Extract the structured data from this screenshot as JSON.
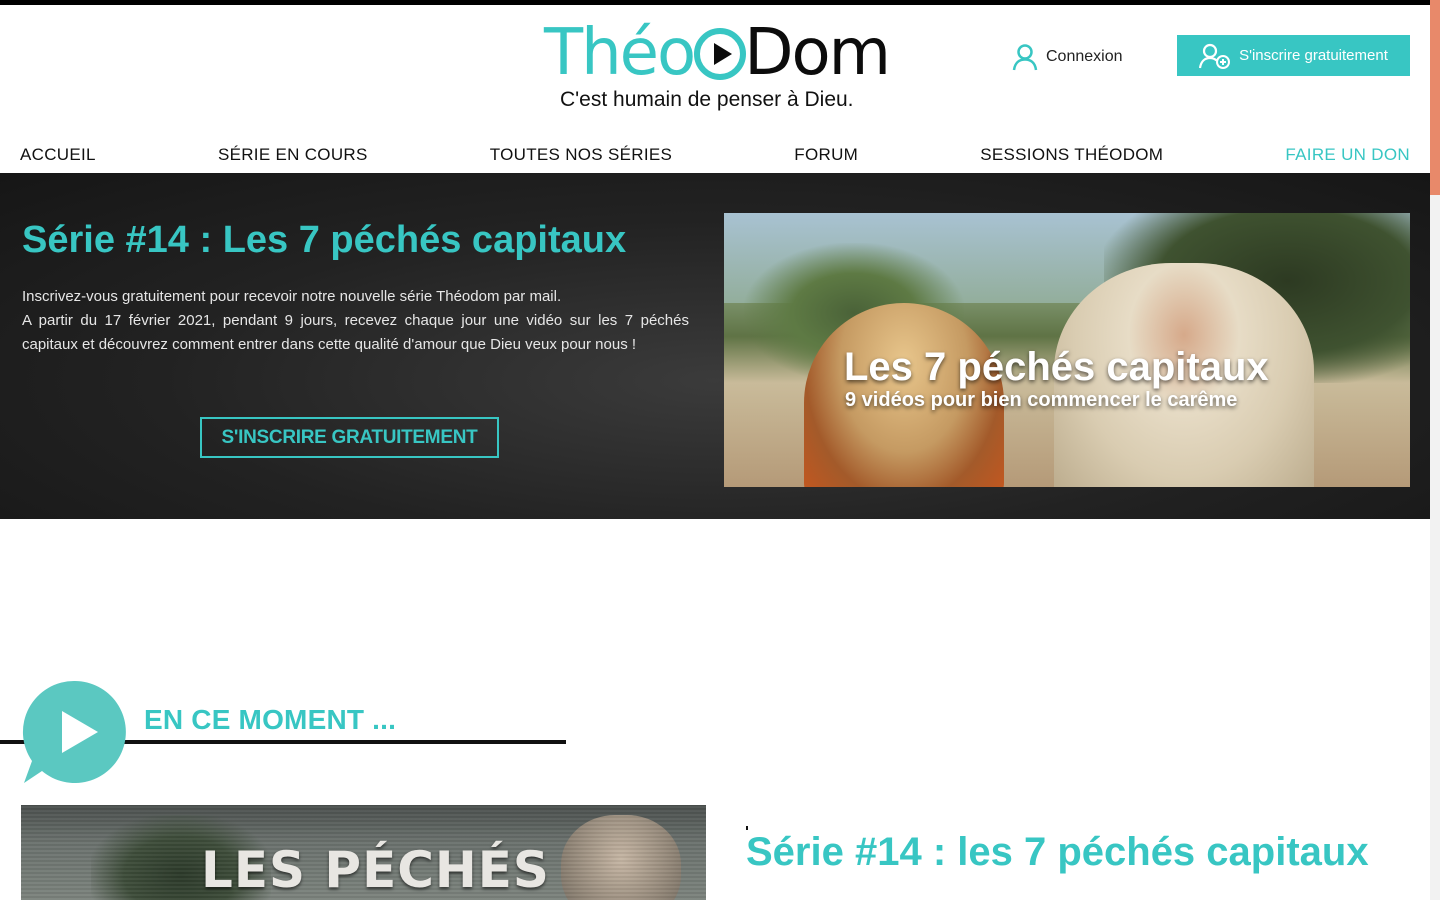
{
  "colors": {
    "accent": "#38c6c3",
    "dark": "#0c0c0c",
    "hero_bg": "#222222",
    "scroll_accent": "#e8896a"
  },
  "header": {
    "logo_part1": "Théo",
    "logo_part2": "Dom",
    "tagline": "C'est humain de penser à Dieu.",
    "login_label": "Connexion",
    "login_icon": "user-icon",
    "signup_label": "S'inscrire gratuitement",
    "signup_icon": "add-user-icon"
  },
  "nav": {
    "items": [
      {
        "label": "ACCUEIL"
      },
      {
        "label": "SÉRIE EN COURS"
      },
      {
        "label": "TOUTES NOS SÉRIES"
      },
      {
        "label": "FORUM"
      },
      {
        "label": "SESSIONS THÉODOM"
      },
      {
        "label": "FAIRE UN DON"
      }
    ]
  },
  "hero": {
    "title": "Série #14 : Les 7 péchés capitaux",
    "text_line1": "Inscrivez-vous gratuitement pour recevoir notre nouvelle série Théodom par mail.",
    "text_line2": "A partir du 17 février 2021, pendant 9 jours, recevez chaque jour une vidéo sur les 7 péchés capitaux et découvrez comment entrer dans cette qualité d'amour que Dieu veux pour nous !",
    "cta_label": "S'INSCRIRE GRATUITEMENT",
    "image_title": "Les 7 péchés capitaux",
    "image_subtitle": "9 vidéos pour bien commencer le carême"
  },
  "now": {
    "section_title": "EN CE MOMENT ...",
    "section_icon": "play-bubble-icon",
    "thumbnail_text": "LES PÉCHÉS",
    "series_title": "Série #14 : les 7 péchés capitaux"
  }
}
